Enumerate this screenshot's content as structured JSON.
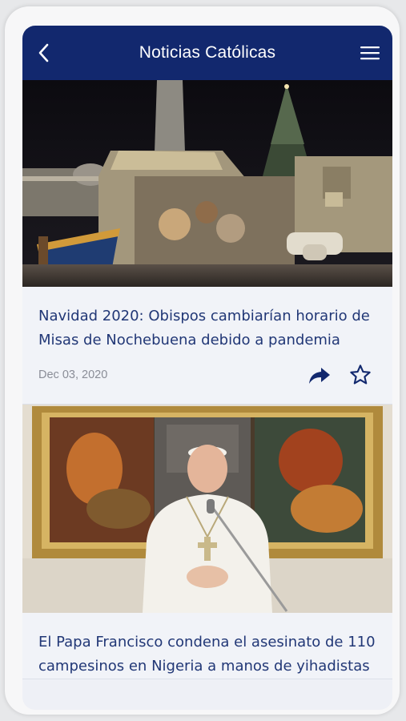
{
  "header": {
    "title": "Noticias Católicas",
    "back_icon": "back-arrow-icon",
    "menu_icon": "menu-icon",
    "background": "#12286e"
  },
  "articles": [
    {
      "title": "Navidad 2020: Obispos cambiarían horario de Misas de Nochebuena debido a pandemia",
      "date": "Dec 03, 2020",
      "share_icon": "share-icon",
      "favorite_icon": "star-outline-icon"
    },
    {
      "title": "El Papa Francisco condena el asesinato de 110 campesinos en Nigeria a manos de yihadistas"
    }
  ],
  "colors": {
    "title_text": "#213776",
    "date_text": "#8a8d97",
    "card_background": "#f1f3f8"
  }
}
